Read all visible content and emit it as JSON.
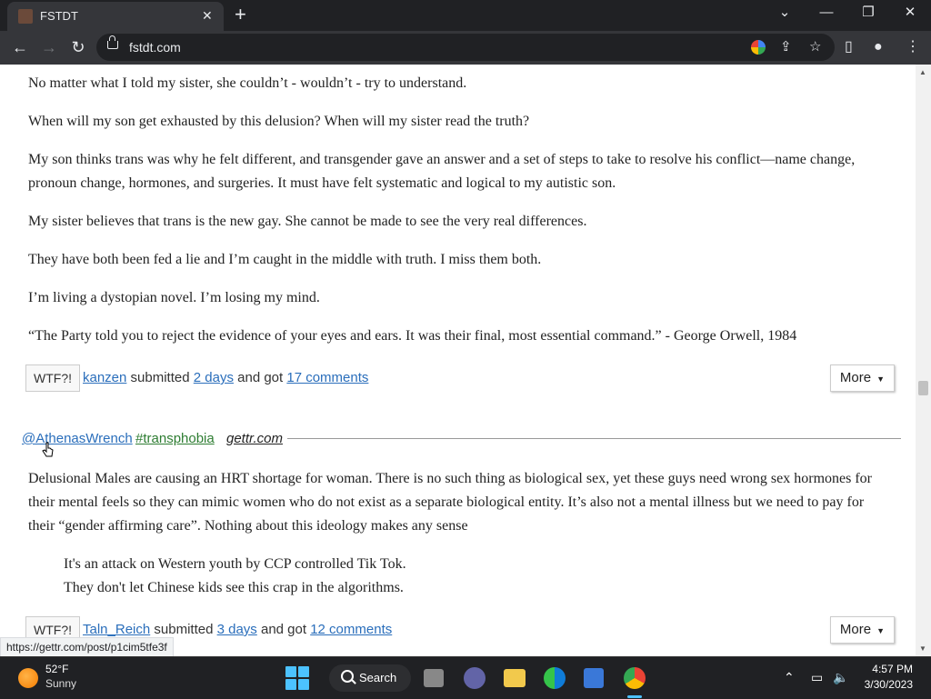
{
  "browser": {
    "tab_title": "FSTDT",
    "url": "fstdt.com",
    "status_url": "https://gettr.com/post/p1cim5tfe3f"
  },
  "post1": {
    "paragraphs": [
      "No matter what I told my sister, she couldn’t - wouldn’t - try to understand.",
      "When will my son get exhausted by this delusion? When will my sister read the truth?",
      "My son thinks trans was why he felt different, and transgender gave an answer and a set of steps to take to resolve his conflict—name change, pronoun change, hormones, and surgeries. It must have felt systematic and logical to my autistic son.",
      "My sister believes that trans is the new gay. She cannot be made to see the very real differences.",
      "They have both been fed a lie and I’m caught in the middle with truth. I miss them both.",
      "I’m living a dystopian novel. I’m losing my mind.",
      "“The Party told you to reject the evidence of your eyes and ears. It was their final, most essential command.” - George Orwell, 1984"
    ],
    "meta": {
      "wtf": "WTF?!",
      "user": "kanzen",
      "submitted": "submitted",
      "time": "2 days",
      "got": "and got",
      "comments": "17 comments",
      "more": "More"
    }
  },
  "post2": {
    "user": "@AthenasWrench",
    "tag": "#transphobia",
    "source": "gettr.com",
    "paragraphs": [
      "Delusional Males are causing an HRT shortage for woman. There is no such thing as biological sex, yet these guys need wrong sex hormones for their mental feels so they can mimic women who do not exist as a separate biological entity. It’s also not a mental illness but we need to pay for their “gender affirming care”. Nothing about this ideology makes any sense"
    ],
    "quote_lines": [
      "It's an attack on Western youth by CCP controlled Tik Tok.",
      "They don't let Chinese kids see this crap in the algorithms."
    ],
    "meta": {
      "wtf": "WTF?!",
      "user": "Taln_Reich",
      "submitted": "submitted",
      "time": "3 days",
      "got": "and got",
      "comments": "12 comments",
      "more": "More"
    }
  },
  "taskbar": {
    "temp": "52°F",
    "weather": "Sunny",
    "search": "Search",
    "time": "4:57 PM",
    "date": "3/30/2023"
  }
}
